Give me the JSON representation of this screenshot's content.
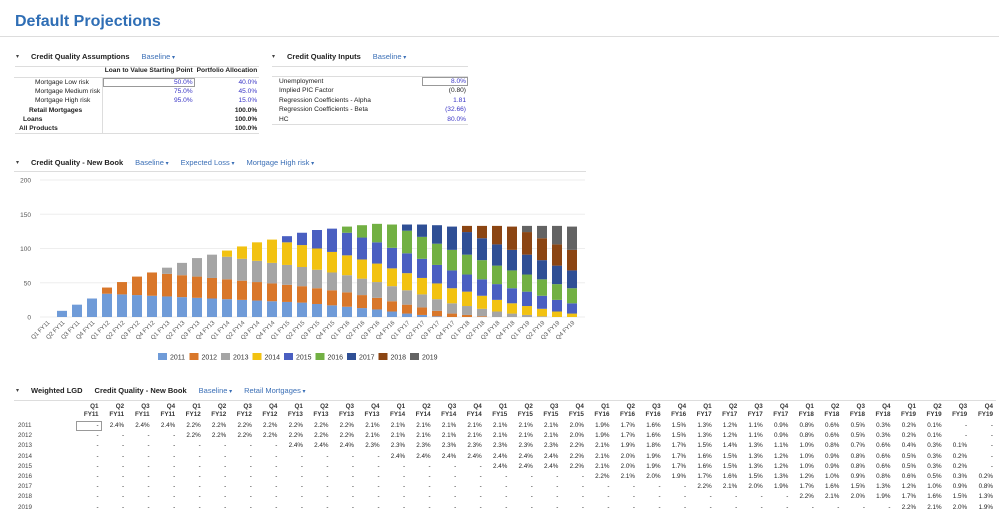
{
  "title": "Default Projections",
  "cqa": {
    "caret": "▾",
    "title": "Credit Quality Assumptions",
    "scenario": "Baseline",
    "headers": [
      "Loan to Value Starting Point",
      "Portfolio Allocation"
    ],
    "rows": [
      {
        "label": "Mortgage Low risk",
        "ltv": "50.0%",
        "alloc": "40.0%"
      },
      {
        "label": "Mortgage Medium risk",
        "ltv": "75.0%",
        "alloc": "45.0%"
      },
      {
        "label": "Mortgage High risk",
        "ltv": "95.0%",
        "alloc": "15.0%"
      },
      {
        "label": "Retail Mortgages",
        "ltv": "",
        "alloc": "100.0%"
      },
      {
        "label": "Loans",
        "ltv": "",
        "alloc": "100.0%"
      },
      {
        "label": "All Products",
        "ltv": "",
        "alloc": "100.0%"
      }
    ]
  },
  "cqi": {
    "caret": "▾",
    "title": "Credit Quality Inputs",
    "scenario": "Baseline",
    "rows": [
      {
        "label": "Unemployment",
        "value": "8.0%"
      },
      {
        "label": "Implied PIC Factor",
        "value": "(0.80)"
      },
      {
        "label": "Regression Coefficients - Alpha",
        "value": "1.81"
      },
      {
        "label": "Regression Coefficients - Beta",
        "value": "(32.66)"
      },
      {
        "label": "HC",
        "value": "80.0%"
      }
    ]
  },
  "cqnb": {
    "caret": "▾",
    "title": "Credit Quality - New Book",
    "scenario": "Baseline",
    "measure": "Expected Loss",
    "product": "Mortgage High risk"
  },
  "chart_data": {
    "type": "bar",
    "stacked": true,
    "ylim": [
      0,
      200
    ],
    "yticks": [
      "0",
      "50",
      "100",
      "150",
      "200"
    ],
    "legend": "bottom",
    "categories": [
      "Q1 FY11",
      "Q2 FY11",
      "Q3 FY11",
      "Q4 FY11",
      "Q1 FY12",
      "Q2 FY12",
      "Q3 FY12",
      "Q4 FY12",
      "Q1 FY13",
      "Q2 FY13",
      "Q3 FY13",
      "Q4 FY13",
      "Q1 FY14",
      "Q2 FY14",
      "Q3 FY14",
      "Q4 FY14",
      "Q1 FY15",
      "Q2 FY15",
      "Q3 FY15",
      "Q4 FY15",
      "Q1 FY16",
      "Q2 FY16",
      "Q3 FY16",
      "Q4 FY16",
      "Q1 FY17",
      "Q2 FY17",
      "Q3 FY17",
      "Q4 FY17",
      "Q1 FY18",
      "Q2 FY18",
      "Q3 FY18",
      "Q4 FY18",
      "Q1 FY19",
      "Q2 FY19",
      "Q3 FY19",
      "Q4 FY19"
    ],
    "series": [
      {
        "name": "2011",
        "color": "#6f9bd8",
        "values": [
          0,
          9,
          18,
          27,
          34,
          33,
          32,
          31,
          30,
          29,
          28,
          27,
          26,
          25,
          24,
          23,
          22,
          21,
          19,
          17,
          15,
          13,
          11,
          8,
          5,
          3,
          1,
          0,
          0,
          0,
          0,
          0,
          0,
          0,
          0,
          0
        ]
      },
      {
        "name": "2012",
        "color": "#d9772a",
        "values": [
          0,
          0,
          0,
          0,
          9,
          18,
          27,
          34,
          33,
          32,
          31,
          30,
          29,
          28,
          27,
          26,
          25,
          24,
          23,
          22,
          21,
          19,
          17,
          15,
          13,
          11,
          8,
          5,
          3,
          1,
          0,
          0,
          0,
          0,
          0,
          0
        ]
      },
      {
        "name": "2013",
        "color": "#a5a5a5",
        "values": [
          0,
          0,
          0,
          0,
          0,
          0,
          0,
          0,
          9,
          18,
          27,
          34,
          33,
          32,
          31,
          30,
          29,
          28,
          27,
          26,
          25,
          24,
          23,
          22,
          21,
          19,
          17,
          15,
          13,
          11,
          8,
          5,
          3,
          1,
          0,
          0
        ]
      },
      {
        "name": "2014",
        "color": "#f2c211",
        "values": [
          0,
          0,
          0,
          0,
          0,
          0,
          0,
          0,
          0,
          0,
          0,
          0,
          9,
          18,
          27,
          34,
          33,
          32,
          31,
          30,
          29,
          28,
          27,
          26,
          25,
          24,
          23,
          22,
          21,
          19,
          17,
          15,
          13,
          11,
          8,
          5
        ]
      },
      {
        "name": "2015",
        "color": "#4a5fc1",
        "values": [
          0,
          0,
          0,
          0,
          0,
          0,
          0,
          0,
          0,
          0,
          0,
          0,
          0,
          0,
          0,
          0,
          9,
          18,
          27,
          34,
          33,
          32,
          31,
          30,
          29,
          28,
          27,
          26,
          25,
          24,
          23,
          22,
          21,
          19,
          17,
          15
        ]
      },
      {
        "name": "2016",
        "color": "#72b043",
        "values": [
          0,
          0,
          0,
          0,
          0,
          0,
          0,
          0,
          0,
          0,
          0,
          0,
          0,
          0,
          0,
          0,
          0,
          0,
          0,
          0,
          9,
          18,
          27,
          34,
          33,
          32,
          31,
          30,
          29,
          28,
          27,
          26,
          25,
          24,
          23,
          22
        ]
      },
      {
        "name": "2017",
        "color": "#2f4f95",
        "values": [
          0,
          0,
          0,
          0,
          0,
          0,
          0,
          0,
          0,
          0,
          0,
          0,
          0,
          0,
          0,
          0,
          0,
          0,
          0,
          0,
          0,
          0,
          0,
          0,
          9,
          18,
          27,
          34,
          33,
          32,
          31,
          30,
          29,
          28,
          27,
          26
        ]
      },
      {
        "name": "2018",
        "color": "#8b4513",
        "values": [
          0,
          0,
          0,
          0,
          0,
          0,
          0,
          0,
          0,
          0,
          0,
          0,
          0,
          0,
          0,
          0,
          0,
          0,
          0,
          0,
          0,
          0,
          0,
          0,
          0,
          0,
          0,
          0,
          9,
          18,
          27,
          34,
          33,
          32,
          31,
          30
        ]
      },
      {
        "name": "2019",
        "color": "#636363",
        "values": [
          0,
          0,
          0,
          0,
          0,
          0,
          0,
          0,
          0,
          0,
          0,
          0,
          0,
          0,
          0,
          0,
          0,
          0,
          0,
          0,
          0,
          0,
          0,
          0,
          0,
          0,
          0,
          0,
          0,
          0,
          0,
          0,
          9,
          18,
          27,
          34
        ]
      }
    ]
  },
  "lgd": {
    "caret": "▾",
    "title": "Weighted LGD",
    "subtitle": "Credit Quality - New Book",
    "scenario": "Baseline",
    "product": "Retail Mortgages",
    "columns": [
      [
        "Q1",
        "FY11"
      ],
      [
        "Q2",
        "FY11"
      ],
      [
        "Q3",
        "FY11"
      ],
      [
        "Q4",
        "FY11"
      ],
      [
        "Q1",
        "FY12"
      ],
      [
        "Q2",
        "FY12"
      ],
      [
        "Q3",
        "FY12"
      ],
      [
        "Q4",
        "FY12"
      ],
      [
        "Q1",
        "FY13"
      ],
      [
        "Q2",
        "FY13"
      ],
      [
        "Q3",
        "FY13"
      ],
      [
        "Q4",
        "FY13"
      ],
      [
        "Q1",
        "FY14"
      ],
      [
        "Q2",
        "FY14"
      ],
      [
        "Q3",
        "FY14"
      ],
      [
        "Q4",
        "FY14"
      ],
      [
        "Q1",
        "FY15"
      ],
      [
        "Q2",
        "FY15"
      ],
      [
        "Q3",
        "FY15"
      ],
      [
        "Q4",
        "FY15"
      ],
      [
        "Q1",
        "FY16"
      ],
      [
        "Q2",
        "FY16"
      ],
      [
        "Q3",
        "FY16"
      ],
      [
        "Q4",
        "FY16"
      ],
      [
        "Q1",
        "FY17"
      ],
      [
        "Q2",
        "FY17"
      ],
      [
        "Q3",
        "FY17"
      ],
      [
        "Q4",
        "FY17"
      ],
      [
        "Q1",
        "FY18"
      ],
      [
        "Q2",
        "FY18"
      ],
      [
        "Q3",
        "FY18"
      ],
      [
        "Q4",
        "FY18"
      ],
      [
        "Q1",
        "FY19"
      ],
      [
        "Q2",
        "FY19"
      ],
      [
        "Q3",
        "FY19"
      ],
      [
        "Q4",
        "FY19"
      ]
    ],
    "rows": [
      {
        "label": "2011",
        "cells": [
          "-",
          "2.4%",
          "2.4%",
          "2.4%",
          "2.2%",
          "2.2%",
          "2.2%",
          "2.2%",
          "2.2%",
          "2.2%",
          "2.2%",
          "2.1%",
          "2.1%",
          "2.1%",
          "2.1%",
          "2.1%",
          "2.1%",
          "2.1%",
          "2.1%",
          "2.0%",
          "1.9%",
          "1.7%",
          "1.6%",
          "1.5%",
          "1.3%",
          "1.2%",
          "1.1%",
          "0.9%",
          "0.8%",
          "0.6%",
          "0.5%",
          "0.3%",
          "0.2%",
          "0.1%",
          "-",
          "-"
        ]
      },
      {
        "label": "2012",
        "cells": [
          "-",
          "-",
          "-",
          "-",
          "2.2%",
          "2.2%",
          "2.2%",
          "2.2%",
          "2.2%",
          "2.2%",
          "2.2%",
          "2.1%",
          "2.1%",
          "2.1%",
          "2.1%",
          "2.1%",
          "2.1%",
          "2.1%",
          "2.1%",
          "2.0%",
          "1.9%",
          "1.7%",
          "1.6%",
          "1.5%",
          "1.3%",
          "1.2%",
          "1.1%",
          "0.9%",
          "0.8%",
          "0.6%",
          "0.5%",
          "0.3%",
          "0.2%",
          "0.1%",
          "-",
          "-"
        ]
      },
      {
        "label": "2013",
        "cells": [
          "-",
          "-",
          "-",
          "-",
          "-",
          "-",
          "-",
          "-",
          "2.4%",
          "2.4%",
          "2.4%",
          "2.3%",
          "2.3%",
          "2.3%",
          "2.3%",
          "2.3%",
          "2.3%",
          "2.3%",
          "2.3%",
          "2.2%",
          "2.1%",
          "1.9%",
          "1.8%",
          "1.7%",
          "1.5%",
          "1.4%",
          "1.3%",
          "1.1%",
          "1.0%",
          "0.8%",
          "0.7%",
          "0.6%",
          "0.4%",
          "0.3%",
          "0.1%",
          "-"
        ]
      },
      {
        "label": "2014",
        "cells": [
          "-",
          "-",
          "-",
          "-",
          "-",
          "-",
          "-",
          "-",
          "-",
          "-",
          "-",
          "-",
          "2.4%",
          "2.4%",
          "2.4%",
          "2.4%",
          "2.4%",
          "2.4%",
          "2.4%",
          "2.2%",
          "2.1%",
          "2.0%",
          "1.9%",
          "1.7%",
          "1.6%",
          "1.5%",
          "1.3%",
          "1.2%",
          "1.0%",
          "0.9%",
          "0.8%",
          "0.6%",
          "0.5%",
          "0.3%",
          "0.2%",
          "-"
        ]
      },
      {
        "label": "2015",
        "cells": [
          "-",
          "-",
          "-",
          "-",
          "-",
          "-",
          "-",
          "-",
          "-",
          "-",
          "-",
          "-",
          "-",
          "-",
          "-",
          "-",
          "2.4%",
          "2.4%",
          "2.4%",
          "2.2%",
          "2.1%",
          "2.0%",
          "1.9%",
          "1.7%",
          "1.6%",
          "1.5%",
          "1.3%",
          "1.2%",
          "1.0%",
          "0.9%",
          "0.8%",
          "0.6%",
          "0.5%",
          "0.3%",
          "0.2%",
          "-"
        ]
      },
      {
        "label": "2016",
        "cells": [
          "-",
          "-",
          "-",
          "-",
          "-",
          "-",
          "-",
          "-",
          "-",
          "-",
          "-",
          "-",
          "-",
          "-",
          "-",
          "-",
          "-",
          "-",
          "-",
          "-",
          "2.2%",
          "2.1%",
          "2.0%",
          "1.9%",
          "1.7%",
          "1.6%",
          "1.5%",
          "1.3%",
          "1.2%",
          "1.0%",
          "0.9%",
          "0.8%",
          "0.6%",
          "0.5%",
          "0.3%",
          "0.2%"
        ]
      },
      {
        "label": "2017",
        "cells": [
          "-",
          "-",
          "-",
          "-",
          "-",
          "-",
          "-",
          "-",
          "-",
          "-",
          "-",
          "-",
          "-",
          "-",
          "-",
          "-",
          "-",
          "-",
          "-",
          "-",
          "-",
          "-",
          "-",
          "-",
          "2.2%",
          "2.1%",
          "2.0%",
          "1.9%",
          "1.7%",
          "1.6%",
          "1.5%",
          "1.3%",
          "1.2%",
          "1.0%",
          "0.9%",
          "0.8%"
        ]
      },
      {
        "label": "2018",
        "cells": [
          "-",
          "-",
          "-",
          "-",
          "-",
          "-",
          "-",
          "-",
          "-",
          "-",
          "-",
          "-",
          "-",
          "-",
          "-",
          "-",
          "-",
          "-",
          "-",
          "-",
          "-",
          "-",
          "-",
          "-",
          "-",
          "-",
          "-",
          "-",
          "2.2%",
          "2.1%",
          "2.0%",
          "1.9%",
          "1.7%",
          "1.6%",
          "1.5%",
          "1.3%"
        ]
      },
      {
        "label": "2019",
        "cells": [
          "-",
          "-",
          "-",
          "-",
          "-",
          "-",
          "-",
          "-",
          "-",
          "-",
          "-",
          "-",
          "-",
          "-",
          "-",
          "-",
          "-",
          "-",
          "-",
          "-",
          "-",
          "-",
          "-",
          "-",
          "-",
          "-",
          "-",
          "-",
          "-",
          "-",
          "-",
          "-",
          "2.2%",
          "2.1%",
          "2.0%",
          "1.9%"
        ]
      }
    ]
  }
}
